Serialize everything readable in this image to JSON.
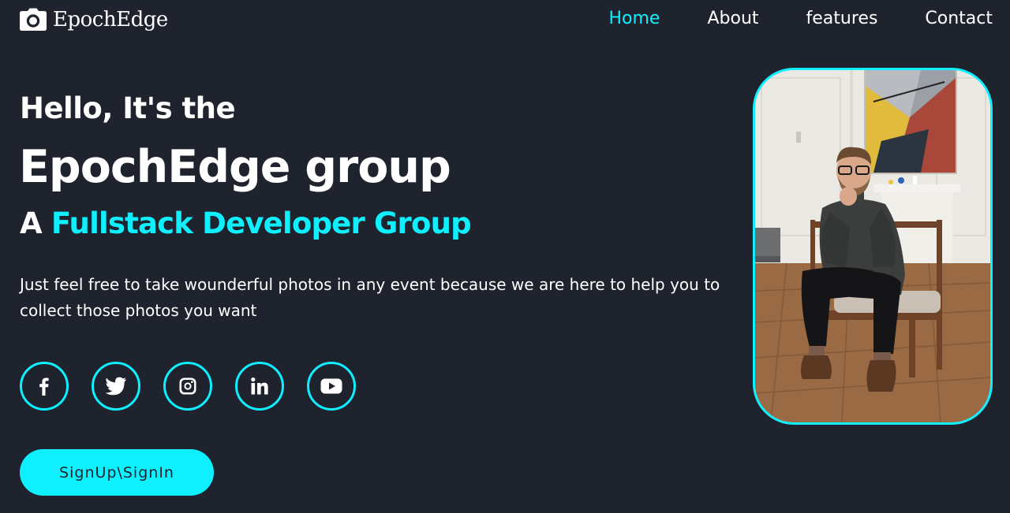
{
  "brand": {
    "name": "EpochEdge",
    "icon": "camera-icon"
  },
  "nav": {
    "items": [
      {
        "label": "Home",
        "active": true
      },
      {
        "label": "About",
        "active": false
      },
      {
        "label": "features",
        "active": false
      },
      {
        "label": "Contact",
        "active": false
      }
    ]
  },
  "hero": {
    "greeting": "Hello, It's the",
    "title": "EpochEdge group",
    "tagline_prefix": "A ",
    "tagline_accent": "Fullstack Developer Group",
    "description": "Just feel free to take wounderful photos in any event because we are here to help you to collect those photos you want",
    "cta_label": "SignUp\\SignIn"
  },
  "socials": [
    {
      "name": "facebook-icon"
    },
    {
      "name": "twitter-icon"
    },
    {
      "name": "instagram-icon"
    },
    {
      "name": "linkedin-icon"
    },
    {
      "name": "youtube-icon"
    }
  ],
  "colors": {
    "accent": "#0ef0ff",
    "background": "#1f232d",
    "text": "#ffffff"
  }
}
